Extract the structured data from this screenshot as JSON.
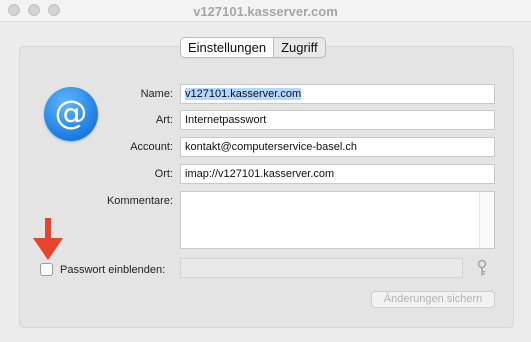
{
  "window": {
    "title": "v127101.kasserver.com"
  },
  "tabs": [
    {
      "label": "Einstellungen",
      "active": true
    },
    {
      "label": "Zugriff",
      "active": false
    }
  ],
  "app_icon": {
    "symbol": "@",
    "icon": "at-sign-icon"
  },
  "form": {
    "name_label": "Name:",
    "name_value": "v127101.kasserver.com",
    "art_label": "Art:",
    "art_value": "Internetpasswort",
    "account_label": "Account:",
    "account_value": "kontakt@computerservice-basel.ch",
    "ort_label": "Ort:",
    "ort_value": "imap://v127101.kasserver.com",
    "kommentare_label": "Kommentare:",
    "kommentare_value": "",
    "show_password_label": "Passwort einblenden:",
    "show_password_checked": false,
    "password_value": ""
  },
  "save_button": {
    "label": "Änderungen sichern",
    "enabled": false
  },
  "colors": {
    "accent": "#1a7de0",
    "annotation_arrow": "#e8432d",
    "selection": "#b3d7ff"
  }
}
